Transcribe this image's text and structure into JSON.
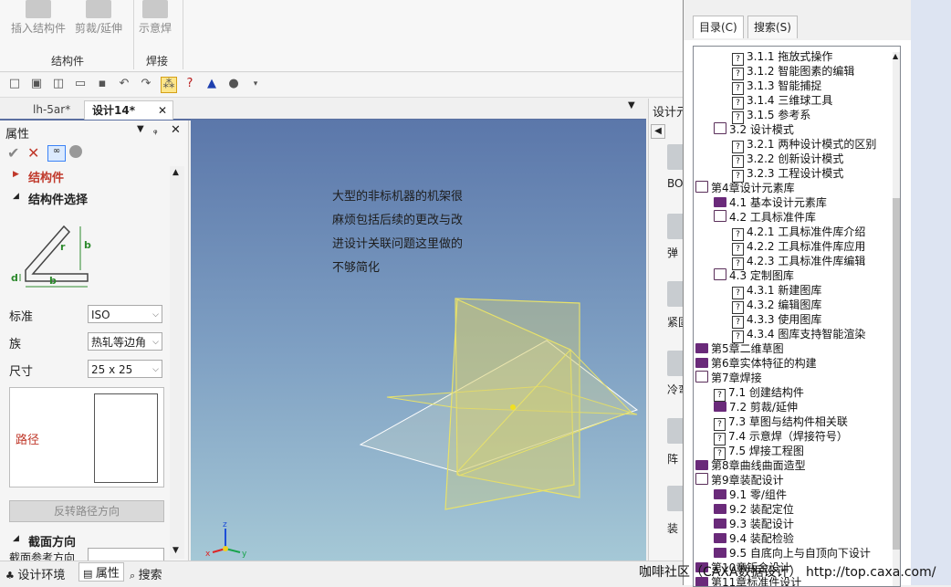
{
  "ribbon": {
    "buttons": [
      "插入结构件",
      "剪裁/延伸",
      "示意焊"
    ],
    "groups": [
      "结构件",
      "焊接"
    ]
  },
  "tabs": [
    "lh-5ar*",
    "设计14*"
  ],
  "properties": {
    "title": "属性",
    "section_structure": "结构件",
    "section_select": "结构件选择",
    "dim_labels": [
      "b",
      "r",
      "d",
      "b"
    ],
    "standard_label": "标准",
    "standard_value": "ISO",
    "family_label": "族",
    "family_value": "热轧等边角",
    "size_label": "尺寸",
    "size_value": "25 x 25",
    "path_label": "路径",
    "reverse_button": "反转路径方向",
    "section_direction": "截面方向",
    "section_ref": "截面参考方向"
  },
  "viewport": {
    "note": "大型的非标机器的机架很麻烦包括后续的更改与改进设计关联问题这里做的不够简化",
    "axes": [
      "z",
      "x",
      "y"
    ]
  },
  "design_elements": {
    "title": "设计元",
    "items": [
      "BO",
      "弹",
      "紧固",
      "冷弯",
      "阵",
      "装"
    ]
  },
  "statusbar": {
    "items": [
      "设计环境",
      "属性",
      "搜索"
    ],
    "watermark": "咖啡社区（CAXA数据设计）  http://top.caxa.com/"
  },
  "help": {
    "tabs": [
      "目录(C)",
      "搜索(S)"
    ],
    "tree": [
      {
        "text": "3.1.1 拖放式操作",
        "type": "q",
        "indent": 2
      },
      {
        "text": "3.1.2 智能图素的编辑",
        "type": "q",
        "indent": 2
      },
      {
        "text": "3.1.3 智能捕捉",
        "type": "q",
        "indent": 2
      },
      {
        "text": "3.1.4 三维球工具",
        "type": "q",
        "indent": 2
      },
      {
        "text": "3.1.5 参考系",
        "type": "q",
        "indent": 2
      },
      {
        "text": "3.2 设计模式",
        "type": "open",
        "indent": 1
      },
      {
        "text": "3.2.1 两种设计模式的区别",
        "type": "q",
        "indent": 2
      },
      {
        "text": "3.2.2 创新设计模式",
        "type": "q",
        "indent": 2
      },
      {
        "text": "3.2.3 工程设计模式",
        "type": "q",
        "indent": 2
      },
      {
        "text": "第4章设计元素库",
        "type": "open",
        "indent": 0
      },
      {
        "text": "4.1 基本设计元素库",
        "type": "closed",
        "indent": 1
      },
      {
        "text": "4.2 工具标准件库",
        "type": "open",
        "indent": 1
      },
      {
        "text": "4.2.1 工具标准件库介绍",
        "type": "q",
        "indent": 2
      },
      {
        "text": "4.2.2 工具标准件库应用",
        "type": "q",
        "indent": 2
      },
      {
        "text": "4.2.3 工具标准件库编辑",
        "type": "q",
        "indent": 2
      },
      {
        "text": "4.3 定制图库",
        "type": "open",
        "indent": 1
      },
      {
        "text": "4.3.1 新建图库",
        "type": "q",
        "indent": 2
      },
      {
        "text": "4.3.2 编辑图库",
        "type": "q",
        "indent": 2
      },
      {
        "text": "4.3.3 使用图库",
        "type": "q",
        "indent": 2
      },
      {
        "text": "4.3.4 图库支持智能渲染",
        "type": "q",
        "indent": 2
      },
      {
        "text": "第5章二维草图",
        "type": "closed",
        "indent": 0
      },
      {
        "text": "第6章实体特征的构建",
        "type": "closed",
        "indent": 0
      },
      {
        "text": "第7章焊接",
        "type": "open",
        "indent": 0
      },
      {
        "text": "7.1 创建结构件",
        "type": "q",
        "indent": 1
      },
      {
        "text": "7.2 剪裁/延伸",
        "type": "closed",
        "indent": 1
      },
      {
        "text": "7.3 草图与结构件相关联",
        "type": "q",
        "indent": 1
      },
      {
        "text": "7.4 示意焊（焊接符号）",
        "type": "q",
        "indent": 1
      },
      {
        "text": "7.5 焊接工程图",
        "type": "q",
        "indent": 1
      },
      {
        "text": "第8章曲线曲面造型",
        "type": "closed",
        "indent": 0
      },
      {
        "text": "第9章装配设计",
        "type": "open",
        "indent": 0
      },
      {
        "text": "9.1 零/组件",
        "type": "closed",
        "indent": 1
      },
      {
        "text": "9.2 装配定位",
        "type": "closed",
        "indent": 1
      },
      {
        "text": "9.3 装配设计",
        "type": "closed",
        "indent": 1
      },
      {
        "text": "9.4 装配检验",
        "type": "closed",
        "indent": 1
      },
      {
        "text": "9.5 自底向上与自顶向下设计",
        "type": "closed",
        "indent": 1
      },
      {
        "text": "第10章钣金设计",
        "type": "closed",
        "indent": 0
      },
      {
        "text": "第11章标准件设计",
        "type": "closed",
        "indent": 0
      }
    ]
  }
}
